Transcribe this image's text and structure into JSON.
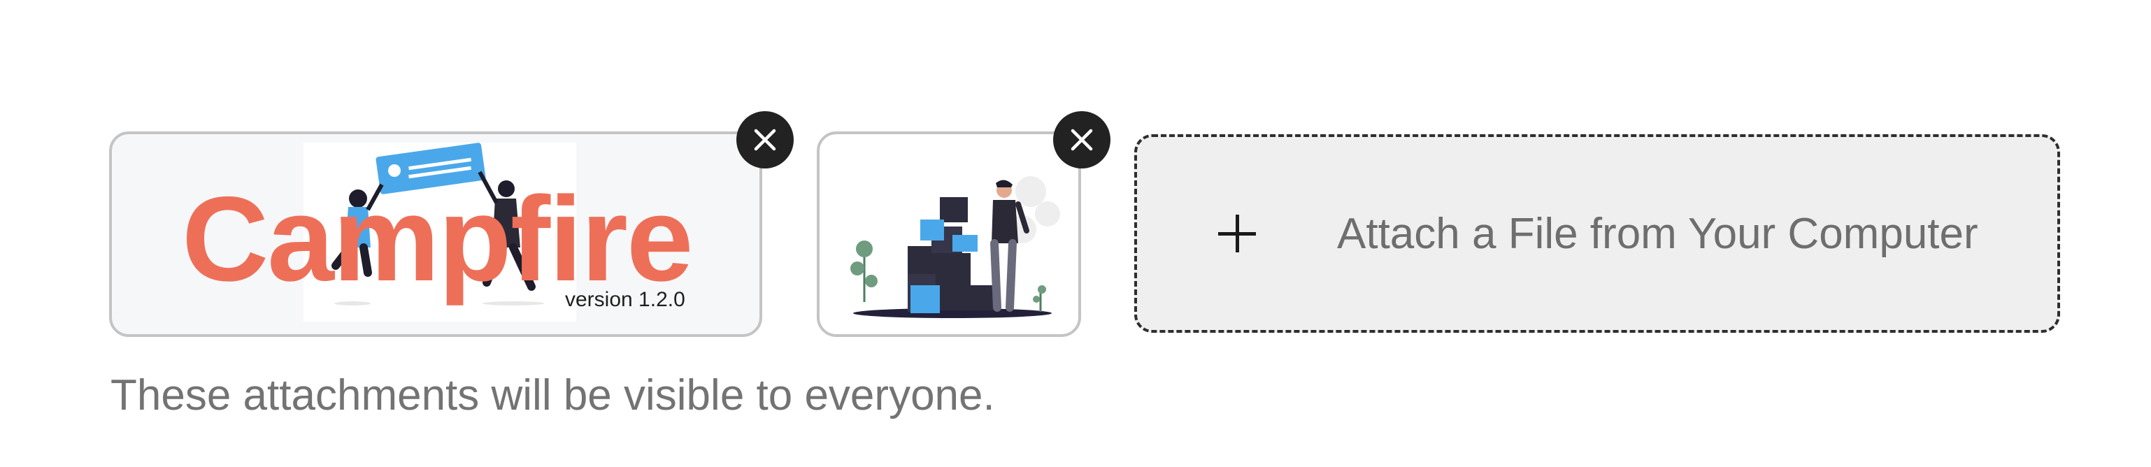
{
  "attachments": [
    {
      "brand_title": "Campfire",
      "brand_version": "version 1.2.0",
      "remove_icon": "close-icon"
    },
    {
      "remove_icon": "close-icon"
    }
  ],
  "dropzone": {
    "icon": "plus-icon",
    "label": "Attach a File from Your Computer"
  },
  "helper_text": "These attachments will be visible to everyone.",
  "colors": {
    "brand": "#ee6f58",
    "accent_blue": "#4aa8ea",
    "dark": "#222222",
    "muted_text": "#737373"
  }
}
